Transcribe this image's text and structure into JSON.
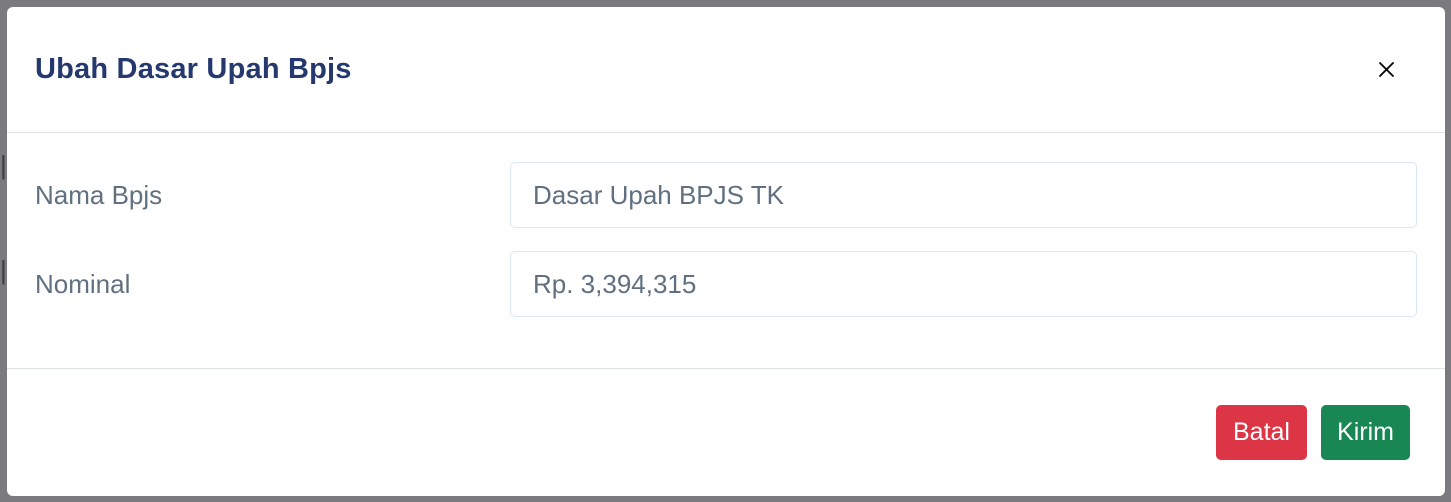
{
  "modal": {
    "title": "Ubah Dasar Upah Bpjs",
    "close_icon": "close-icon"
  },
  "form": {
    "fields": [
      {
        "label": "Nama Bpjs",
        "value": "Dasar Upah BPJS TK"
      },
      {
        "label": "Nominal",
        "value": "Rp. 3,394,315"
      }
    ]
  },
  "footer": {
    "cancel_label": "Batal",
    "submit_label": "Kirim"
  },
  "colors": {
    "title": "#25396f",
    "label": "#607080",
    "cancel": "#dc3545",
    "submit": "#198754"
  }
}
